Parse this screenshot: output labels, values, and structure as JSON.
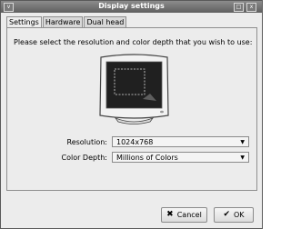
{
  "window": {
    "title": "Display settings",
    "controls": {
      "minimize": "v",
      "maximize": "□",
      "close": "x"
    }
  },
  "tabs": [
    {
      "label": "Settings",
      "active": true
    },
    {
      "label": "Hardware",
      "active": false
    },
    {
      "label": "Dual head",
      "active": false
    }
  ],
  "settings": {
    "instruction": "Please select the resolution and color depth that you wish to use:",
    "resolution": {
      "label": "Resolution:",
      "accel": "R",
      "value": "1024x768"
    },
    "color_depth": {
      "label": "Color Depth:",
      "accel": "C",
      "value": "Millions of Colors"
    }
  },
  "buttons": {
    "cancel": {
      "label": "Cancel",
      "icon": "cancel-icon"
    },
    "ok": {
      "label": "OK",
      "icon": "ok-icon"
    }
  }
}
